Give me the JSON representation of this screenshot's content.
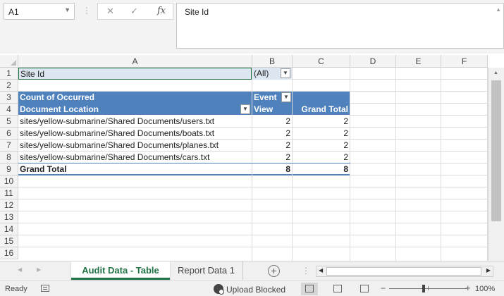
{
  "formula_bar": {
    "name_box": "A1",
    "cancel_glyph": "✕",
    "enter_glyph": "✓",
    "fx_glyph": "fx",
    "content": "Site Id"
  },
  "columns": [
    "A",
    "B",
    "C",
    "D",
    "E",
    "F"
  ],
  "rows": [
    "1",
    "2",
    "3",
    "4",
    "5",
    "6",
    "7",
    "8",
    "9",
    "10",
    "11",
    "12",
    "13",
    "14",
    "15",
    "16"
  ],
  "filter": {
    "label": "Site Id",
    "value": "(All)"
  },
  "pivot": {
    "header_row3_a": "Count of Occurred",
    "header_row3_b": "Event",
    "header_row4_a": "Document Location",
    "header_row4_b": "View",
    "header_row4_c": "Grand Total",
    "rows": [
      {
        "location": "sites/yellow-submarine/Shared Documents/users.txt",
        "view": "2",
        "total": "2"
      },
      {
        "location": "sites/yellow-submarine/Shared Documents/boats.txt",
        "view": "2",
        "total": "2"
      },
      {
        "location": "sites/yellow-submarine/Shared Documents/planes.txt",
        "view": "2",
        "total": "2"
      },
      {
        "location": "sites/yellow-submarine/Shared Documents/cars.txt",
        "view": "2",
        "total": "2"
      }
    ],
    "grand_total_label": "Grand Total",
    "grand_total_view": "8",
    "grand_total_total": "8"
  },
  "sheet_tabs": {
    "active": "Audit Data - Table",
    "other": "Report Data 1",
    "add_glyph": "+"
  },
  "status_bar": {
    "ready": "Ready",
    "upload": "Upload Blocked",
    "zoom_minus": "−",
    "zoom_plus": "+",
    "zoom": "100%"
  },
  "icons": {
    "dropdown": "chevron-down-icon",
    "filter_dropdown": "filter-dropdown-icon",
    "add_sheet": "plus-circle-icon",
    "upload": "upload-blocked-icon"
  },
  "colors": {
    "pivot_header": "#4f81bd",
    "filter_band": "#dce6f1",
    "active_tab": "#217346"
  }
}
